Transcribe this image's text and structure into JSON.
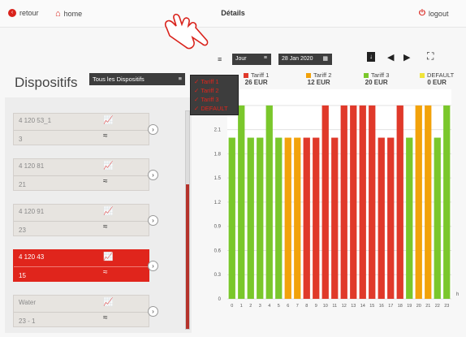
{
  "topbar": {
    "back_label": "retour",
    "home_label": "home",
    "title": "Détails",
    "logout_label": "logout"
  },
  "controls": {
    "period": "Jour",
    "date": "28 Jan 2020"
  },
  "sidebar": {
    "heading": "Dispositifs",
    "filter": "Tous les Dispositifs",
    "devices": [
      {
        "id": "4 120 53_1",
        "value": "3",
        "active": false
      },
      {
        "id": "4 120 81",
        "value": "21",
        "active": false
      },
      {
        "id": "4 120 91",
        "value": "23",
        "active": false
      },
      {
        "id": "4 120 43",
        "value": "15",
        "active": true
      },
      {
        "id": "Water",
        "value": "23 - 1",
        "active": false
      }
    ]
  },
  "tariff_menu": [
    "Tariff 1",
    "Tariff 2",
    "Tariff 3",
    "DEFAULT"
  ],
  "legend": [
    {
      "name": "Tariff 1",
      "eur": "26 EUR",
      "color": "#e0392a"
    },
    {
      "name": "Tariff 2",
      "eur": "12 EUR",
      "color": "#f2a20a"
    },
    {
      "name": "Tariff 3",
      "eur": "20 EUR",
      "color": "#7ac72b"
    },
    {
      "name": "DEFAULT",
      "eur": "0 EUR",
      "color": "#f0e43a"
    }
  ],
  "chart_data": {
    "type": "bar",
    "categories": [
      "0",
      "1",
      "2",
      "3",
      "4",
      "5",
      "6",
      "7",
      "8",
      "9",
      "10",
      "11",
      "12",
      "13",
      "14",
      "15",
      "16",
      "17",
      "18",
      "19",
      "20",
      "21",
      "22",
      "23"
    ],
    "values": [
      2.0,
      2.4,
      2.0,
      2.0,
      2.4,
      2.0,
      2.0,
      2.0,
      2.0,
      2.0,
      2.4,
      2.0,
      2.4,
      2.4,
      2.4,
      2.4,
      2.0,
      2.0,
      2.4,
      2.0,
      2.4,
      2.4,
      2.0,
      2.4
    ],
    "tariff": [
      "Tariff 3",
      "Tariff 3",
      "Tariff 3",
      "Tariff 3",
      "Tariff 3",
      "Tariff 3",
      "Tariff 2",
      "Tariff 2",
      "Tariff 1",
      "Tariff 1",
      "Tariff 1",
      "Tariff 1",
      "Tariff 1",
      "Tariff 1",
      "Tariff 1",
      "Tariff 1",
      "Tariff 1",
      "Tariff 1",
      "Tariff 1",
      "Tariff 3",
      "Tariff 2",
      "Tariff 2",
      "Tariff 3",
      "Tariff 3"
    ],
    "yticks": [
      "0",
      "0.3",
      "0.6",
      "0.9",
      "1.2",
      "1.5",
      "1.8",
      "2.1",
      "2.4"
    ],
    "ylim": [
      0,
      2.6
    ],
    "xlabel": "h",
    "ylabel": ""
  }
}
